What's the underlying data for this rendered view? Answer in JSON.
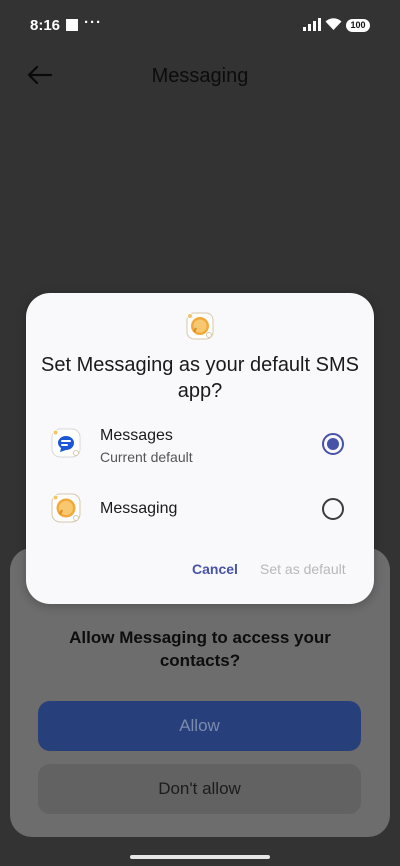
{
  "status_bar": {
    "time": "8:16",
    "dots": "···",
    "battery": "100"
  },
  "app_bar": {
    "title": "Messaging"
  },
  "permission_sheet": {
    "title": "Allow Messaging to access your contacts?",
    "allow_label": "Allow",
    "deny_label": "Don't allow"
  },
  "dialog": {
    "title": "Set Messaging as your default SMS app?",
    "options": [
      {
        "label": "Messages",
        "sublabel": "Current default",
        "selected": true,
        "icon": "messages-app-icon"
      },
      {
        "label": "Messaging",
        "sublabel": "",
        "selected": false,
        "icon": "messaging-app-icon"
      }
    ],
    "cancel_label": "Cancel",
    "set_default_label": "Set as default"
  },
  "colors": {
    "accent": "#4753a6",
    "scrim": "#333333",
    "dialog_bg": "#f9f9fb"
  }
}
